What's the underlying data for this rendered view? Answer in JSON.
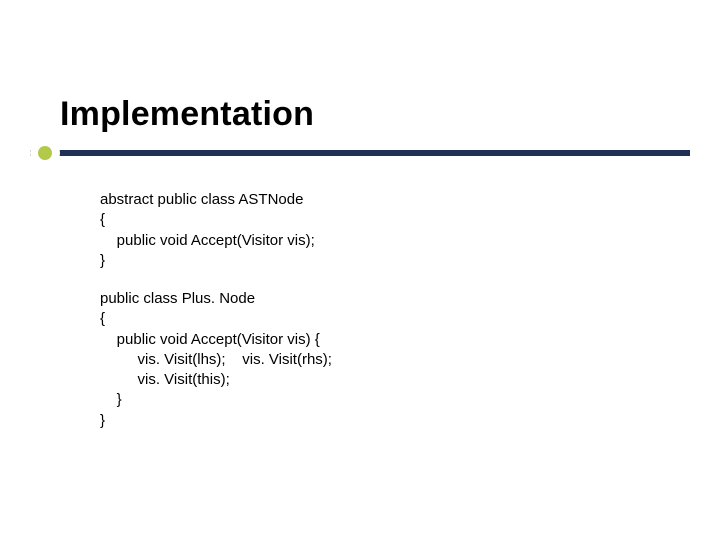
{
  "title": "Implementation",
  "code1": "abstract public class ASTNode\n{\n    public void Accept(Visitor vis);\n}",
  "code2": "public class Plus. Node\n{\n    public void Accept(Visitor vis) {\n         vis. Visit(lhs);    vis. Visit(rhs);\n         vis. Visit(this);\n    }\n}"
}
